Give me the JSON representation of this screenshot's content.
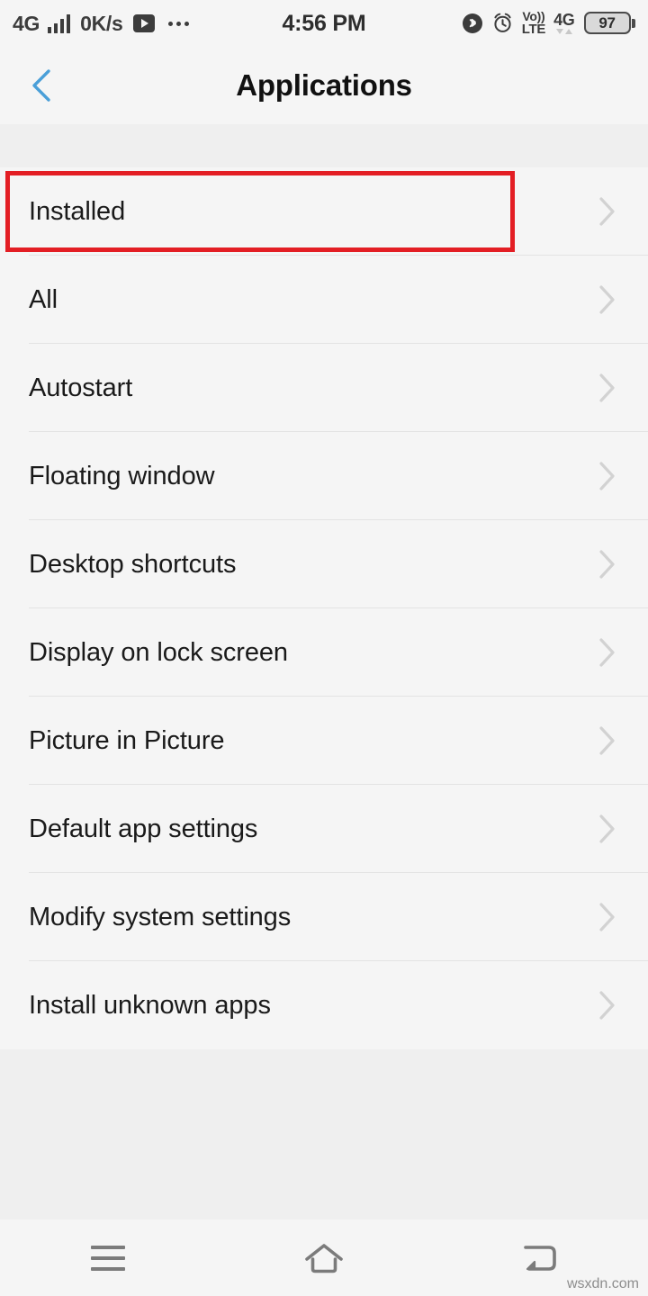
{
  "status_bar": {
    "network_type": "4G",
    "signal_icon": "signal-bars-icon",
    "data_speed": "0K/s",
    "play_icon": "play-badge-icon",
    "overflow_icon": "more-dots-icon",
    "clock": "4:56 PM",
    "bluetooth_icon": "bluetooth-icon",
    "alarm_icon": "alarm-clock-icon",
    "volte_top": "Vo))",
    "volte_bottom": "LTE",
    "network_badge": "4G",
    "battery_percent": "97"
  },
  "header": {
    "back_icon": "back-chevron-icon",
    "title": "Applications"
  },
  "list": {
    "items": [
      {
        "label": "Installed",
        "chevron": "chevron-right-icon",
        "highlighted": true
      },
      {
        "label": "All",
        "chevron": "chevron-right-icon",
        "highlighted": false
      },
      {
        "label": "Autostart",
        "chevron": "chevron-right-icon",
        "highlighted": false
      },
      {
        "label": "Floating window",
        "chevron": "chevron-right-icon",
        "highlighted": false
      },
      {
        "label": "Desktop shortcuts",
        "chevron": "chevron-right-icon",
        "highlighted": false
      },
      {
        "label": "Display on lock screen",
        "chevron": "chevron-right-icon",
        "highlighted": false
      },
      {
        "label": "Picture in Picture",
        "chevron": "chevron-right-icon",
        "highlighted": false
      },
      {
        "label": "Default app settings",
        "chevron": "chevron-right-icon",
        "highlighted": false
      },
      {
        "label": "Modify system settings",
        "chevron": "chevron-right-icon",
        "highlighted": false
      },
      {
        "label": "Install unknown apps",
        "chevron": "chevron-right-icon",
        "highlighted": false
      }
    ]
  },
  "annotation": {
    "color": "#e31e24",
    "target": "Installed"
  },
  "nav_bar": {
    "menu_icon": "hamburger-menu-icon",
    "home_icon": "home-icon",
    "back_icon": "back-arrow-icon"
  },
  "watermark": {
    "text": "wsxdn.com"
  },
  "colors": {
    "accent_blue": "#4a9fd8",
    "surface": "#f5f5f5",
    "background": "#efefef",
    "divider": "#e3e3e3",
    "chevron": "#d2d2d2",
    "annotation_red": "#e31e24"
  }
}
